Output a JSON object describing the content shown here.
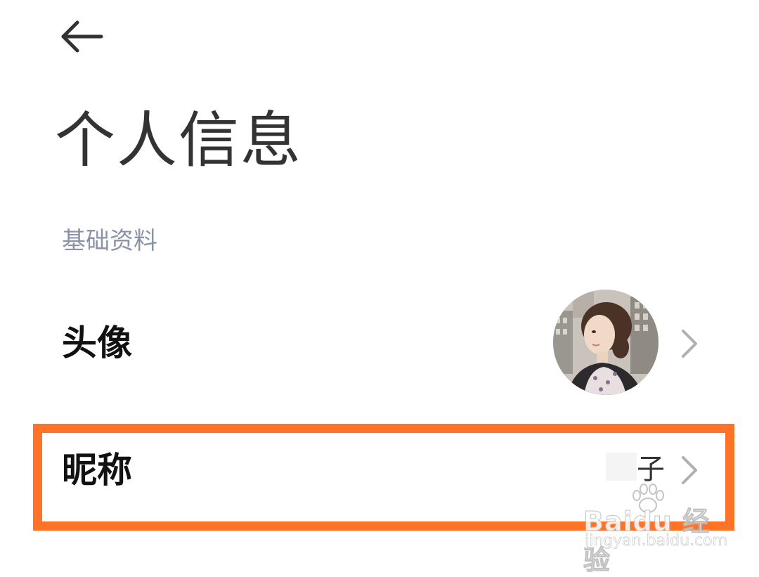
{
  "header": {
    "back_icon": "arrow-left-icon",
    "title": "个人信息"
  },
  "section": {
    "label": "基础资料"
  },
  "rows": [
    {
      "label": "头像",
      "value_type": "avatar-image",
      "icon": "chevron-right-icon"
    },
    {
      "label": "昵称",
      "value": "子",
      "icon": "chevron-right-icon"
    }
  ],
  "highlight": {
    "target": "昵称",
    "color": "#ff7328"
  },
  "watermark": {
    "brand": "Baidu 经验",
    "url": "jingyan.baidu.com"
  },
  "colors": {
    "title": "#333333",
    "section_label": "#8a93a8",
    "row_label": "#111111",
    "chevron": "#b0b0b0",
    "highlight": "#ff7328"
  }
}
